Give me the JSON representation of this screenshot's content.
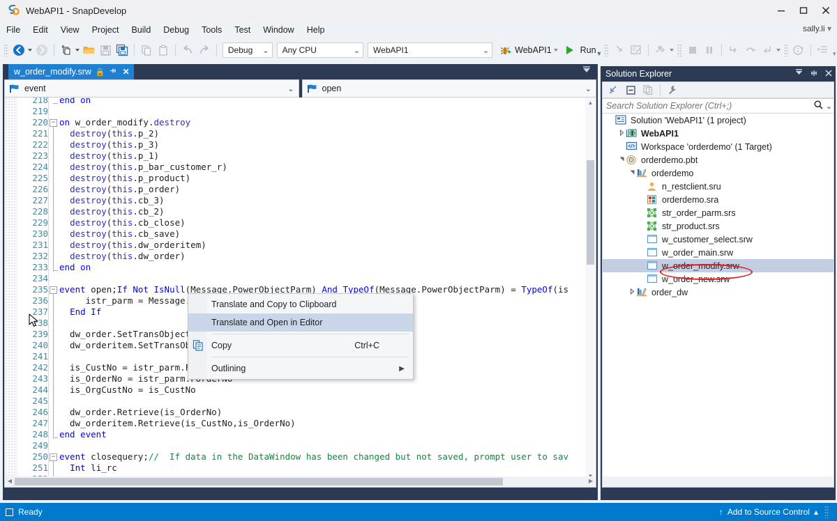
{
  "window": {
    "title": "WebAPI1 - SnapDevelop",
    "logo_icon": "snapdevelop-logo-icon",
    "minimize_label": "—",
    "maximize_label": "❑",
    "close_label": "✕"
  },
  "menu": {
    "items": [
      "File",
      "Edit",
      "View",
      "Project",
      "Build",
      "Debug",
      "Tools",
      "Test",
      "Window",
      "Help"
    ],
    "user": "sally.li"
  },
  "toolbar": {
    "back_icon": "navigate-back-icon",
    "forward_icon": "navigate-forward-icon",
    "new_icon": "new-item-icon",
    "open_icon": "open-folder-icon",
    "save_icon": "save-icon",
    "save_all_icon": "save-all-icon",
    "copy_icon": "copy-icon",
    "paste_icon": "paste-icon",
    "undo_icon": "undo-icon",
    "redo_icon": "redo-icon",
    "configuration": "Debug",
    "platform": "Any CPU",
    "startup_project": "WebAPI1",
    "debug_target_icon": "bug-icon",
    "debug_target": "WebAPI1",
    "run_label": "Run",
    "run_icon": "run-play-icon",
    "step_icons": [
      "step-into-icon",
      "breakpoint-window-icon",
      "build-icon",
      "stop-icon",
      "pause-icon",
      "step-over-icon",
      "step-out-icon",
      "step-return-icon",
      "info-icon",
      "indent-icon"
    ]
  },
  "editor": {
    "tab": {
      "filename": "w_order_modify.srw",
      "lock_icon": "lock-icon",
      "pin_icon": "pin-icon",
      "close_icon": "close-icon"
    },
    "overflow_icon": "tab-overflow-icon",
    "nav_left": {
      "icon": "event-flag-icon",
      "value": "event",
      "chevron": "˅"
    },
    "nav_right": {
      "icon": "event-flag-icon",
      "value": "open",
      "chevron": "˅"
    },
    "lines": [
      {
        "num": 218,
        "text": "end on",
        "kind": "keyword-end",
        "fold": "end"
      },
      {
        "num": 219,
        "text": "",
        "kind": "blank"
      },
      {
        "num": 220,
        "text": "on w_order_modify.destroy",
        "kind": "event-start",
        "fold": "open"
      },
      {
        "num": 221,
        "text": "  destroy(this.p_2)",
        "kind": "code"
      },
      {
        "num": 222,
        "text": "  destroy(this.p_3)",
        "kind": "code"
      },
      {
        "num": 223,
        "text": "  destroy(this.p_1)",
        "kind": "code"
      },
      {
        "num": 224,
        "text": "  destroy(this.p_bar_customer_r)",
        "kind": "code"
      },
      {
        "num": 225,
        "text": "  destroy(this.p_product)",
        "kind": "code"
      },
      {
        "num": 226,
        "text": "  destroy(this.p_order)",
        "kind": "code"
      },
      {
        "num": 227,
        "text": "  destroy(this.cb_3)",
        "kind": "code"
      },
      {
        "num": 228,
        "text": "  destroy(this.cb_2)",
        "kind": "code"
      },
      {
        "num": 229,
        "text": "  destroy(this.cb_close)",
        "kind": "code"
      },
      {
        "num": 230,
        "text": "  destroy(this.cb_save)",
        "kind": "code"
      },
      {
        "num": 231,
        "text": "  destroy(this.dw_orderitem)",
        "kind": "code"
      },
      {
        "num": 232,
        "text": "  destroy(this.dw_order)",
        "kind": "code"
      },
      {
        "num": 233,
        "text": "end on",
        "kind": "keyword-end",
        "fold": "end"
      },
      {
        "num": 234,
        "text": "",
        "kind": "blank"
      },
      {
        "num": 235,
        "text": "event open;If Not IsNull(Message.PowerObjectParm) And TypeOf(Message.PowerObjectParm) = TypeOf(is",
        "kind": "event-start",
        "fold": "open"
      },
      {
        "num": 236,
        "text": "     istr_parm = Message.",
        "kind": "code"
      },
      {
        "num": 237,
        "text": "  End If",
        "kind": "code"
      },
      {
        "num": 238,
        "text": "",
        "kind": "blank"
      },
      {
        "num": 239,
        "text": "  dw_order.SetTransObject(",
        "kind": "code"
      },
      {
        "num": 240,
        "text": "  dw_orderitem.SetTransObj",
        "kind": "code"
      },
      {
        "num": 241,
        "text": "",
        "kind": "blank"
      },
      {
        "num": 242,
        "text": "  is_CustNo = istr_parm.FCustNo",
        "kind": "code"
      },
      {
        "num": 243,
        "text": "  is_OrderNo = istr_parm.FOrderNo",
        "kind": "code"
      },
      {
        "num": 244,
        "text": "  is_OrgCustNo = is_CustNo",
        "kind": "code"
      },
      {
        "num": 245,
        "text": "",
        "kind": "blank"
      },
      {
        "num": 246,
        "text": "  dw_order.Retrieve(is_OrderNo)",
        "kind": "code"
      },
      {
        "num": 247,
        "text": "  dw_orderitem.Retrieve(is_CustNo,is_OrderNo)",
        "kind": "code"
      },
      {
        "num": 248,
        "text": "end event",
        "kind": "keyword-end",
        "fold": "end"
      },
      {
        "num": 249,
        "text": "",
        "kind": "blank"
      },
      {
        "num": 250,
        "text": "event closequery;//  If data in the DataWindow has been changed but not saved, prompt user to sav",
        "kind": "event-comment",
        "fold": "open"
      },
      {
        "num": 251,
        "text": "  Int li_rc",
        "kind": "code"
      },
      {
        "num": 252,
        "text": "",
        "kind": "blank"
      }
    ]
  },
  "context_menu": {
    "items": [
      {
        "label": "Translate and Copy to Clipboard",
        "shortcut": "",
        "icon": "",
        "selected": false,
        "submenu": false
      },
      {
        "label": "Translate and Open in Editor",
        "shortcut": "",
        "icon": "",
        "selected": true,
        "submenu": false
      },
      {
        "label": "Copy",
        "shortcut": "Ctrl+C",
        "icon": "copy-icon",
        "selected": false,
        "submenu": false
      },
      {
        "label": "Outlining",
        "shortcut": "",
        "icon": "",
        "selected": false,
        "submenu": true
      }
    ],
    "cursor_icon": "mouse-pointer-icon"
  },
  "solution_explorer": {
    "title": "Solution Explorer",
    "header_buttons": [
      "dropdown-icon",
      "pin-icon",
      "close-icon"
    ],
    "toolbar_icons": [
      "collapse-all-icon",
      "show-all-files-icon",
      "properties-icon",
      "wrench-icon"
    ],
    "search": {
      "placeholder": "Search Solution Explorer (Ctrl+;)",
      "search_icon": "search-icon",
      "chevron_icon": "chevron-down-icon"
    },
    "tree": [
      {
        "label": "Solution 'WebAPI1' (1 project)",
        "indent": 0,
        "expander": "",
        "icon": "solution-icon",
        "bold": false,
        "selected": false
      },
      {
        "label": "WebAPI1",
        "indent": 1,
        "expander": "collapsed",
        "icon": "project-web-icon",
        "bold": true,
        "selected": false
      },
      {
        "label": "Workspace 'orderdemo' (1 Target)",
        "indent": 1,
        "expander": "",
        "icon": "workspace-icon",
        "bold": false,
        "selected": false
      },
      {
        "label": "orderdemo.pbt",
        "indent": 1,
        "expander": "expanded",
        "icon": "target-icon",
        "bold": false,
        "selected": false
      },
      {
        "label": "orderdemo",
        "indent": 2,
        "expander": "expanded",
        "icon": "library-icon",
        "bold": false,
        "selected": false
      },
      {
        "label": "n_restclient.sru",
        "indent": 3,
        "expander": "",
        "icon": "user-object-icon",
        "bold": false,
        "selected": false
      },
      {
        "label": "orderdemo.sra",
        "indent": 3,
        "expander": "",
        "icon": "application-icon",
        "bold": false,
        "selected": false
      },
      {
        "label": "str_order_parm.srs",
        "indent": 3,
        "expander": "",
        "icon": "structure-icon",
        "bold": false,
        "selected": false
      },
      {
        "label": "str_product.srs",
        "indent": 3,
        "expander": "",
        "icon": "structure-icon",
        "bold": false,
        "selected": false
      },
      {
        "label": "w_customer_select.srw",
        "indent": 3,
        "expander": "",
        "icon": "window-icon",
        "bold": false,
        "selected": false
      },
      {
        "label": "w_order_main.srw",
        "indent": 3,
        "expander": "",
        "icon": "window-icon",
        "bold": false,
        "selected": false
      },
      {
        "label": "w_order_modify.srw",
        "indent": 3,
        "expander": "",
        "icon": "window-icon",
        "bold": false,
        "selected": true,
        "annotated": true
      },
      {
        "label": "w_order_new.srw",
        "indent": 3,
        "expander": "",
        "icon": "window-icon",
        "bold": false,
        "selected": false
      },
      {
        "label": "order_dw",
        "indent": 2,
        "expander": "collapsed",
        "icon": "library-icon",
        "bold": false,
        "selected": false
      }
    ]
  },
  "statusbar": {
    "state_icon": "ready-square-icon",
    "state": "Ready",
    "source_control_icon": "up-arrow-icon",
    "source_control": "Add to Source Control",
    "source_control_chevron": "▴"
  },
  "colors": {
    "accent_blue": "#007acc",
    "tab_active": "#1f7fd1",
    "dock_bg": "#2d3a53",
    "keyword": "#0000ff",
    "comment": "#0f8a3c",
    "linenum": "#2b91af",
    "annotation_red": "#e8191c",
    "selection": "#c3cee3",
    "menu_selection": "#c9d6ea"
  }
}
